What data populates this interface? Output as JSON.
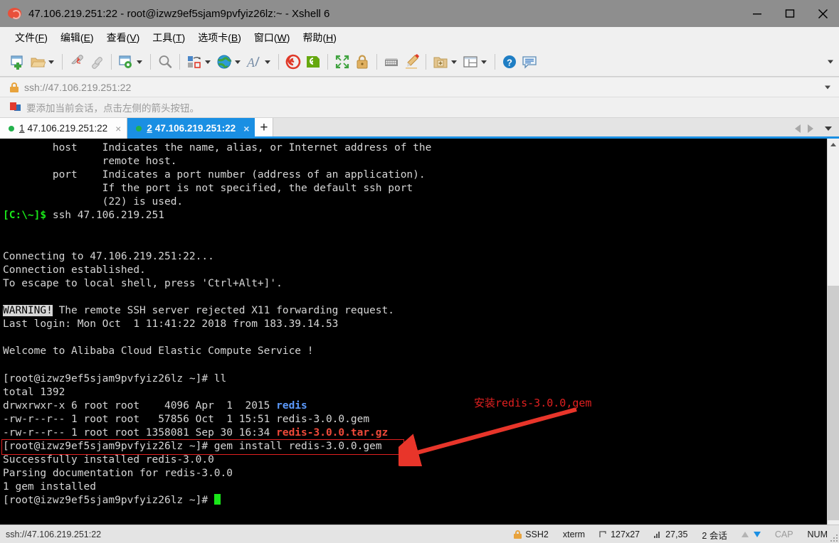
{
  "window": {
    "title": "47.106.219.251:22 - root@izwz9ef5sjam9pvfyiz26lz:~ - Xshell 6",
    "app_icon": "snail-icon",
    "minimize_label": "Minimize",
    "maximize_label": "Maximize",
    "close_label": "Close"
  },
  "menubar": {
    "items": [
      {
        "label": "文件",
        "accel": "F"
      },
      {
        "label": "编辑",
        "accel": "E"
      },
      {
        "label": "查看",
        "accel": "V"
      },
      {
        "label": "工具",
        "accel": "T"
      },
      {
        "label": "选项卡",
        "accel": "B"
      },
      {
        "label": "窗口",
        "accel": "W"
      },
      {
        "label": "帮助",
        "accel": "H"
      }
    ]
  },
  "toolbar": {
    "items": [
      {
        "name": "new-session-icon",
        "dropdown": false
      },
      {
        "name": "open-folder-icon",
        "dropdown": true
      },
      {
        "name": "disconnect-icon",
        "dropdown": false
      },
      {
        "name": "reconnect-icon",
        "dropdown": false
      },
      {
        "name": "session-properties-icon",
        "dropdown": true
      },
      {
        "name": "find-icon",
        "dropdown": false
      },
      {
        "name": "transfer-file-icon",
        "dropdown": true
      },
      {
        "name": "globe-icon",
        "dropdown": true
      },
      {
        "name": "font-icon",
        "dropdown": true
      },
      {
        "name": "xshell-logo-icon",
        "dropdown": false
      },
      {
        "name": "xftp-icon",
        "dropdown": false
      },
      {
        "name": "fullscreen-icon",
        "dropdown": false
      },
      {
        "name": "lock-icon",
        "dropdown": false
      },
      {
        "name": "keyboard-icon",
        "dropdown": false
      },
      {
        "name": "highlight-pen-icon",
        "dropdown": false
      },
      {
        "name": "add-folder-icon",
        "dropdown": true
      },
      {
        "name": "layout-icon",
        "dropdown": true
      },
      {
        "name": "help-icon",
        "dropdown": false
      },
      {
        "name": "feedback-icon",
        "dropdown": false
      }
    ],
    "overflow_label": "More toolbar buttons"
  },
  "address_bar": {
    "value": "ssh://47.106.219.251:22",
    "lock_icon": "lock-icon",
    "dropdown_icon": "chevron-down-icon"
  },
  "hint_bar": {
    "icon": "flag-icon",
    "text": "要添加当前会话，点击左侧的箭头按钮。"
  },
  "tabbar": {
    "tabs": [
      {
        "number": "1",
        "label": "47.106.219.251:22",
        "active": false,
        "status": "connected"
      },
      {
        "number": "2",
        "label": "47.106.219.251:22",
        "active": true,
        "status": "connected"
      }
    ],
    "add_tab_label": "+",
    "close_label": "×",
    "nav_prev_label": "Previous tab",
    "nav_next_label": "Next tab"
  },
  "terminal": {
    "columns": 127,
    "rows": 27,
    "lines": [
      {
        "segments": [
          {
            "t": "        host    Indicates the name, alias, or Internet address of the",
            "c": ""
          }
        ]
      },
      {
        "segments": [
          {
            "t": "                remote host.",
            "c": ""
          }
        ]
      },
      {
        "segments": [
          {
            "t": "        port    Indicates a port number (address of an application).",
            "c": ""
          }
        ]
      },
      {
        "segments": [
          {
            "t": "                If the port is not specified, the default ssh port",
            "c": ""
          }
        ]
      },
      {
        "segments": [
          {
            "t": "                (22) is used.",
            "c": ""
          }
        ]
      },
      {
        "segments": [
          {
            "t": "[C:\\~]$",
            "c": "g"
          },
          {
            "t": " ssh 47.106.219.251",
            "c": ""
          }
        ]
      },
      {
        "segments": [
          {
            "t": "",
            "c": ""
          }
        ]
      },
      {
        "segments": [
          {
            "t": "",
            "c": ""
          }
        ]
      },
      {
        "segments": [
          {
            "t": "Connecting to 47.106.219.251:22...",
            "c": ""
          }
        ]
      },
      {
        "segments": [
          {
            "t": "Connection established.",
            "c": ""
          }
        ]
      },
      {
        "segments": [
          {
            "t": "To escape to local shell, press 'Ctrl+Alt+]'.",
            "c": ""
          }
        ]
      },
      {
        "segments": [
          {
            "t": "",
            "c": ""
          }
        ]
      },
      {
        "segments": [
          {
            "t": "WARNING!",
            "c": "inv"
          },
          {
            "t": " The remote SSH server rejected X11 forwarding request.",
            "c": ""
          }
        ]
      },
      {
        "segments": [
          {
            "t": "Last login: Mon Oct  1 11:41:22 2018 from 183.39.14.53",
            "c": ""
          }
        ]
      },
      {
        "segments": [
          {
            "t": "",
            "c": ""
          }
        ]
      },
      {
        "segments": [
          {
            "t": "Welcome to Alibaba Cloud Elastic Compute Service !",
            "c": ""
          }
        ]
      },
      {
        "segments": [
          {
            "t": "",
            "c": ""
          }
        ]
      },
      {
        "segments": [
          {
            "t": "[root@izwz9ef5sjam9pvfyiz26lz ~]# ll",
            "c": ""
          }
        ]
      },
      {
        "segments": [
          {
            "t": "total 1392",
            "c": ""
          }
        ]
      },
      {
        "segments": [
          {
            "t": "drwxrwxr-x 6 root root    4096 Apr  1  2015 ",
            "c": ""
          },
          {
            "t": "redis",
            "c": "b"
          }
        ]
      },
      {
        "segments": [
          {
            "t": "-rw-r--r-- 1 root root   57856 Oct  1 15:51 redis-3.0.0.gem",
            "c": ""
          }
        ]
      },
      {
        "segments": [
          {
            "t": "-rw-r--r-- 1 root root 1358081 Sep 30 16:34 ",
            "c": ""
          },
          {
            "t": "redis-3.0.0.tar.gz",
            "c": "r"
          }
        ]
      },
      {
        "segments": [
          {
            "t": "[root@izwz9ef5sjam9pvfyiz26lz ~]# gem install redis-3.0.0.gem",
            "c": ""
          }
        ]
      },
      {
        "segments": [
          {
            "t": "Successfully installed redis-3.0.0",
            "c": ""
          }
        ]
      },
      {
        "segments": [
          {
            "t": "Parsing documentation for redis-3.0.0",
            "c": ""
          }
        ]
      },
      {
        "segments": [
          {
            "t": "1 gem installed",
            "c": ""
          }
        ]
      },
      {
        "segments": [
          {
            "t": "[root@izwz9ef5sjam9pvfyiz26lz ~]# ",
            "c": "",
            "cursor": true
          }
        ]
      }
    ]
  },
  "annotation": {
    "text": "安装redis-3.0.0,gem",
    "color": "#e02020",
    "highlight_target": "[root@izwz9ef5sjam9pvfyiz26lz ~]# gem install redis-3.0.0.gem"
  },
  "scrollbar": {
    "up_label": "Scroll up",
    "down_label": "Scroll down",
    "thumb_label": "Scroll thumb"
  },
  "statusbar": {
    "connection": "ssh://47.106.219.251:22",
    "protocol": "SSH2",
    "terminal_type": "xterm",
    "size": "127x27",
    "cursor_pos": "27,35",
    "sessions": "2 会话",
    "cap": "CAP",
    "num": "NUM"
  }
}
